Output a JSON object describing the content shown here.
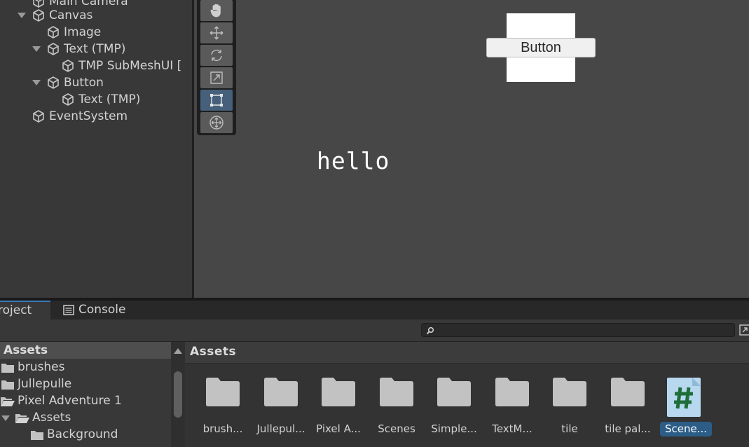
{
  "hierarchy": {
    "items": [
      {
        "label": "Main Camera",
        "expanded": null
      },
      {
        "label": "Canvas",
        "expanded": true
      },
      {
        "label": "Image",
        "expanded": null
      },
      {
        "label": "Text (TMP)",
        "expanded": true
      },
      {
        "label": "TMP SubMeshUI [",
        "expanded": null
      },
      {
        "label": "Button",
        "expanded": true
      },
      {
        "label": "Text (TMP)",
        "expanded": null
      },
      {
        "label": "EventSystem",
        "expanded": null
      }
    ]
  },
  "scene": {
    "tools": [
      "hand-tool-icon",
      "move-tool-icon",
      "rotate-tool-icon",
      "scale-tool-icon",
      "rect-tool-icon",
      "transform-tool-icon"
    ],
    "active_tool": "rect-tool-icon",
    "button_text": "Button",
    "hello_text": "hello"
  },
  "bottom": {
    "tabs": {
      "project": "roject",
      "console": "Console"
    },
    "search": {
      "value": "",
      "placeholder": ""
    },
    "tree": {
      "header": "Assets",
      "items": [
        {
          "label": "brushes"
        },
        {
          "label": "Jullepulle"
        },
        {
          "label": "Pixel Adventure 1"
        },
        {
          "label": "Assets"
        },
        {
          "label": "Background"
        }
      ]
    },
    "grid": {
      "header": "Assets",
      "items": [
        {
          "label": "brush...",
          "type": "folder"
        },
        {
          "label": "Jullepul...",
          "type": "folder"
        },
        {
          "label": "Pixel A...",
          "type": "folder"
        },
        {
          "label": "Scenes",
          "type": "folder"
        },
        {
          "label": "Simple...",
          "type": "folder"
        },
        {
          "label": "TextM...",
          "type": "folder"
        },
        {
          "label": "tile",
          "type": "folder"
        },
        {
          "label": "tile pal...",
          "type": "folder"
        },
        {
          "label": "Scene...",
          "type": "script",
          "selected": true
        }
      ]
    }
  },
  "colors": {
    "selection": "#2c5d87",
    "active_tool": "#46607c",
    "scene_bg": "#474747",
    "panel_bg": "#383838"
  }
}
